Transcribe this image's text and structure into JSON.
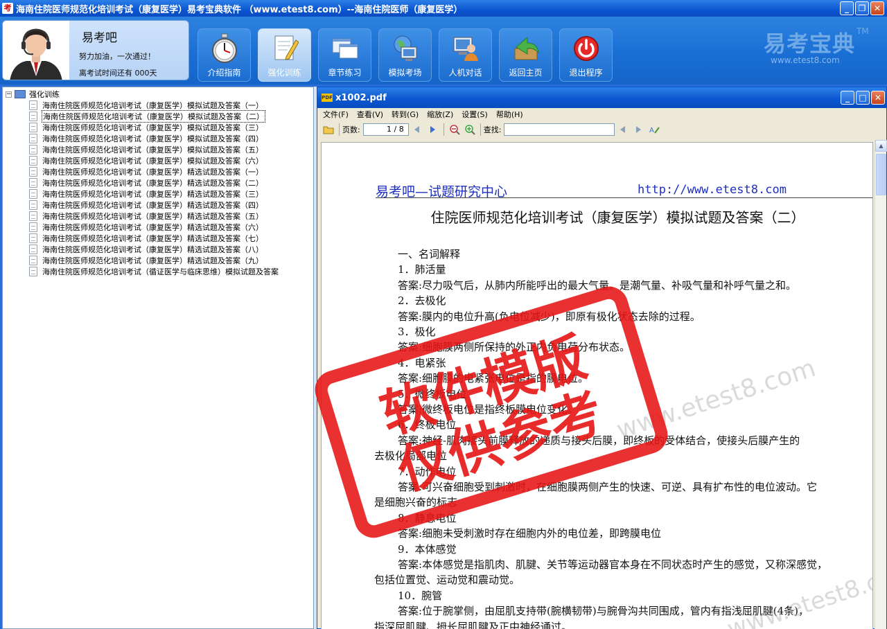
{
  "window": {
    "title": "海南住院医师规范化培训考试（康复医学）易考宝典软件 （www.etest8.com）--海南住院医师（康复医学）",
    "app_icon": "考"
  },
  "profile": {
    "name": "易考吧",
    "motto": "努力加油，一次通过！",
    "countdown": "离考试时间还有 000天"
  },
  "nav": {
    "buttons": [
      {
        "label": "介绍指南",
        "icon": "stopwatch-icon"
      },
      {
        "label": "强化训练",
        "icon": "notepad-pencil-icon",
        "active": true
      },
      {
        "label": "章节练习",
        "icon": "windows-icon"
      },
      {
        "label": "模拟考场",
        "icon": "computer-globe-icon"
      },
      {
        "label": "人机对话",
        "icon": "user-computer-icon"
      },
      {
        "label": "返回主页",
        "icon": "return-arrow-icon"
      },
      {
        "label": "退出程序",
        "icon": "power-icon"
      }
    ]
  },
  "brand": {
    "name": "易考宝典",
    "tm": "TM",
    "url": "www.etest8.com"
  },
  "tree": {
    "root": "强化训练",
    "items": [
      "海南住院医师规范化培训考试（康复医学）模拟试题及答案（一）",
      "海南住院医师规范化培训考试（康复医学）模拟试题及答案（二）",
      "海南住院医师规范化培训考试（康复医学）模拟试题及答案（三）",
      "海南住院医师规范化培训考试（康复医学）模拟试题及答案（四）",
      "海南住院医师规范化培训考试（康复医学）模拟试题及答案（五）",
      "海南住院医师规范化培训考试（康复医学）模拟试题及答案（六）",
      "海南住院医师规范化培训考试（康复医学）精选试题及答案（一）",
      "海南住院医师规范化培训考试（康复医学）精选试题及答案（二）",
      "海南住院医师规范化培训考试（康复医学）精选试题及答案（三）",
      "海南住院医师规范化培训考试（康复医学）精选试题及答案（四）",
      "海南住院医师规范化培训考试（康复医学）精选试题及答案（五）",
      "海南住院医师规范化培训考试（康复医学）精选试题及答案（六）",
      "海南住院医师规范化培训考试（康复医学）精选试题及答案（七）",
      "海南住院医师规范化培训考试（康复医学）精选试题及答案（八）",
      "海南住院医师规范化培训考试（康复医学）精选试题及答案（九）",
      "海南住院医师规范化培训考试（循证医学与临床思维）模拟试题及答案"
    ],
    "selected_index": 1
  },
  "pdf": {
    "title": "x1002.pdf",
    "menus": [
      "文件(F)",
      "查看(V)",
      "转到(G)",
      "缩放(Z)",
      "设置(S)",
      "帮助(H)"
    ],
    "page_label": "页数:",
    "page_value": "1 / 8",
    "find_label": "查找:"
  },
  "document": {
    "header_left": "易考吧—试题研究中心",
    "header_right": "http://www.etest8.com",
    "title": "住院医师规范化培训考试（康复医学）模拟试题及答案（二）",
    "lines": [
      "一、名词解释",
      "1．肺活量",
      "答案:尽力吸气后，从肺内所能呼出的最大气量。是潮气量、补吸气量和补呼气量之和。",
      "2．去极化",
      "答案:膜内的电位升高(负电位减少)，即原有极化状态去除的过程。",
      "3．极化",
      "答案:细胞膜两侧所保持的外正内负电荷分布状态。",
      "4．电紧张",
      "答案:细胞膜的电紧张电位是指的膜电位。",
      "5．微终板电位",
      "答案:微终板电位是指终板膜电位变化。",
      "6．终板电位",
      "答案:神经-肌肉接头前膜释放的递质与接头后膜，即终板的受体结合，使接头后膜产生的",
      "去极化局部电位",
      "7．动作电位",
      "答案:可兴奋细胞受到刺激时，在细胞膜两侧产生的快速、可逆、具有扩布性的电位波动。它",
      "是细胞兴奋的标志",
      "8．静息电位",
      "答案:细胞未受刺激时存在细胞内外的电位差，即跨膜电位",
      "9．本体感觉",
      "答案:本体感觉是指肌肉、肌腱、关节等运动器官本身在不同状态时产生的感觉，又称深感觉，",
      "包括位置觉、运动觉和震动觉。",
      "10．腕管",
      "答案:位于腕掌侧，由屈肌支持带(腕横韧带)与腕骨沟共同围成，管内有指浅屈肌腱(4条)，",
      "指深屈肌腱、拇长屈肌腱及正中神经通过。"
    ]
  },
  "watermark": {
    "stamp_line1": "软件模版",
    "stamp_line2": "仅供参考",
    "url": "www.etest8.com",
    "stamp_color": "#e61414"
  },
  "colors": {
    "accent": "#1a6fd4",
    "link_blue": "#1c2fbf"
  }
}
